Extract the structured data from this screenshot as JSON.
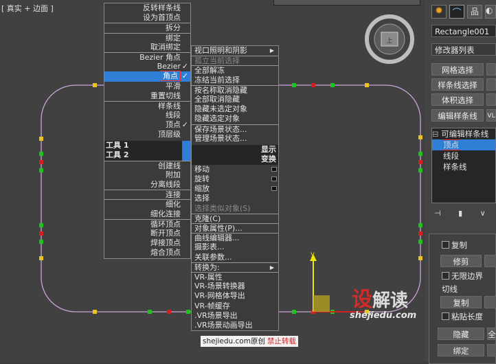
{
  "viewport": {
    "label": "[ 真实 + 边面 ]"
  },
  "quad_left": [
    {
      "label": "反转样条线"
    },
    {
      "label": "设为首顶点"
    },
    {
      "label": "拆分",
      "sep": true
    },
    {
      "label": "绑定",
      "sep": true
    },
    {
      "label": "取消绑定"
    },
    {
      "label": "Bezier 角点",
      "sep": true
    },
    {
      "label": "Bezier",
      "check": "✓"
    },
    {
      "label": "角点",
      "hl": true,
      "check": "✓"
    },
    {
      "label": "平滑"
    },
    {
      "label": "重置切线"
    },
    {
      "label": "样条线",
      "sep": true
    },
    {
      "label": "线段"
    },
    {
      "label": "顶点",
      "check": "✓"
    },
    {
      "label": "顶层级"
    }
  ],
  "quad_hdr": {
    "tools1": "工具 1",
    "display": "显示",
    "tools2": "工具 2",
    "transform": "变换"
  },
  "quad_left2": [
    {
      "label": "创建线",
      "sep": true
    },
    {
      "label": "附加"
    },
    {
      "label": "分离线段"
    },
    {
      "label": "连接",
      "sep": true
    },
    {
      "label": "细化",
      "sep": true
    },
    {
      "label": "细化连接"
    },
    {
      "label": "循环顶点",
      "sep": true
    },
    {
      "label": "断开顶点"
    },
    {
      "label": "焊接顶点"
    },
    {
      "label": "熔合顶点"
    }
  ],
  "quad_right": [
    {
      "label": "视口照明和阴影",
      "arrow": "▶"
    },
    {
      "label": "孤立当前选择",
      "dis": true,
      "sep": true
    },
    {
      "label": "全部解冻",
      "sep": true
    },
    {
      "label": "冻结当前选择"
    },
    {
      "label": "按名称取消隐藏",
      "sep": true
    },
    {
      "label": "全部取消隐藏"
    },
    {
      "label": "隐藏未选定对象"
    },
    {
      "label": "隐藏选定对象"
    },
    {
      "label": "保存场景状态...",
      "sep": true
    },
    {
      "label": "管理场景状态..."
    }
  ],
  "quad_right2": [
    {
      "label": "移动",
      "sq": true
    },
    {
      "label": "旋转",
      "sq": true
    },
    {
      "label": "缩放",
      "sq": true
    },
    {
      "label": "选择"
    },
    {
      "label": "选择类似对象(S)",
      "dis": true
    },
    {
      "label": "克隆(C)",
      "sep": true
    },
    {
      "label": "对象属性(P)...",
      "sep": true
    },
    {
      "label": "曲线编辑器...",
      "sep": true
    },
    {
      "label": "摄影表..."
    },
    {
      "label": "关联参数..."
    },
    {
      "label": "转换为:",
      "arrow": "▶",
      "sep": true
    },
    {
      "label": "VR-属性",
      "sep": true
    },
    {
      "label": "VR-场景转换器"
    },
    {
      "label": "VR-网格体导出"
    },
    {
      "label": "VR-帧缓存"
    },
    {
      "label": ".VR场景导出"
    },
    {
      "label": ".VR场景动画导出"
    }
  ],
  "panel": {
    "object_name": "Rectangle001",
    "modifier_list": "修改器列表",
    "buttons": [
      "网格选择",
      "样条线选择",
      "体积选择",
      "编辑样条线"
    ],
    "vl": "VL",
    "tree": [
      "可编辑样条线",
      "顶点",
      "线段",
      "样条线"
    ],
    "copy": "复制",
    "modify": "修剪",
    "infinite": "无限边界",
    "tangent": "切线",
    "copy2": "复制",
    "paste_len": "粘贴长度",
    "hide": "隐藏",
    "all": "全",
    "bind": "绑定"
  },
  "axis": {
    "y": "y",
    "x": "x"
  },
  "watermark": {
    "site": "shejiedu.com",
    "logo_a": "设",
    "logo_b": "解读",
    "footer_site": "shejiedu.com原创",
    "footer_note": "禁止转载"
  },
  "colors": {
    "highlight": "#2f7fd6",
    "vertex_red": "#d42020",
    "vertex_green": "#1ec41e",
    "vertex_yellow": "#e8c520"
  }
}
